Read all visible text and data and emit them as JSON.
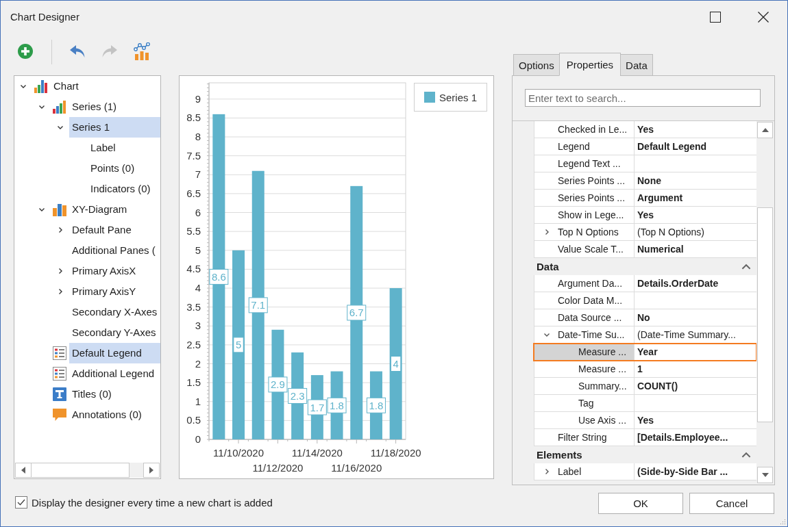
{
  "window": {
    "title": "Chart Designer"
  },
  "toolbar": {
    "groups": [
      [
        {
          "kind": "add",
          "disabled": false
        }
      ],
      [
        {
          "kind": "undo",
          "disabled": false
        },
        {
          "kind": "redo",
          "disabled": true
        },
        {
          "kind": "wizard",
          "disabled": false
        }
      ]
    ]
  },
  "tree": [
    {
      "label": "Chart",
      "kind": "chart",
      "expanded": true,
      "selected": false,
      "children": [
        {
          "label": "Series (1)",
          "kind": "series",
          "expanded": true,
          "selected": false,
          "children": [
            {
              "label": "Series 1",
              "expanded": true,
              "selected": true,
              "children": [
                {
                  "label": "Label",
                  "selected": false
                },
                {
                  "label": "Points (0)",
                  "selected": false
                },
                {
                  "label": "Indicators (0)",
                  "selected": false
                }
              ]
            }
          ]
        },
        {
          "label": "XY-Diagram",
          "kind": "diagram",
          "expanded": true,
          "selected": false,
          "children": [
            {
              "label": "Default Pane",
              "expanded": false,
              "selected": false
            },
            {
              "label": "Additional Panes (",
              "selected": false
            },
            {
              "label": "Primary AxisX",
              "expanded": false,
              "selected": false
            },
            {
              "label": "Primary AxisY",
              "expanded": false,
              "selected": false
            },
            {
              "label": "Secondary X-Axes",
              "selected": false
            },
            {
              "label": "Secondary Y-Axes",
              "selected": false
            }
          ]
        },
        {
          "label": "Default Legend",
          "kind": "legend",
          "selected": true
        },
        {
          "label": "Additional Legend",
          "kind": "legend",
          "selected": false
        },
        {
          "label": "Titles (0)",
          "kind": "titles",
          "selected": false
        },
        {
          "label": "Annotations (0)",
          "kind": "annotations",
          "selected": false
        }
      ]
    }
  ],
  "chart": {
    "chart_data": {
      "type": "bar",
      "categories": [
        null,
        "11/10/2020",
        null,
        "11/12/2020",
        null,
        "11/14/2020",
        null,
        "11/16/2020",
        null,
        "11/18/2020"
      ],
      "ylim": [
        0,
        9.43
      ],
      "yticks": [
        0,
        0.5,
        1,
        1.5,
        2,
        2.5,
        3,
        3.5,
        4,
        4.5,
        5,
        5.5,
        6,
        6.5,
        7,
        7.5,
        8,
        8.5,
        9
      ],
      "grid": true,
      "data_labels": true,
      "series": [
        {
          "name": "Series 1",
          "color": "#5fb3cb",
          "values": [
            8.6,
            5,
            7.1,
            2.9,
            2.3,
            1.7,
            1.8,
            6.7,
            1.8,
            4
          ]
        }
      ]
    }
  },
  "tabs": [
    {
      "label": "Options",
      "selected": false
    },
    {
      "label": "Properties",
      "selected": true
    },
    {
      "label": "Data",
      "selected": false
    }
  ],
  "search": {
    "placeholder": "Enter text to search..."
  },
  "property_grid": {
    "sections": [
      {
        "rows": [
          {
            "name": "Checked in Le...",
            "value": "Yes",
            "modified": true,
            "selected": false
          },
          {
            "name": "Legend",
            "value": "Default Legend",
            "modified": true,
            "selected": false
          },
          {
            "name": "Legend Text ...",
            "selected": false
          },
          {
            "name": "Series Points ...",
            "value": "None",
            "modified": true,
            "selected": false
          },
          {
            "name": "Series Points ...",
            "value": "Argument",
            "modified": true,
            "selected": false
          },
          {
            "name": "Show in Lege...",
            "value": "Yes",
            "modified": true,
            "selected": false
          },
          {
            "name": "Top N Options",
            "value": "(Top N Options)",
            "modified": false,
            "expanded": false,
            "selected": false
          },
          {
            "name": "Value Scale T...",
            "value": "Numerical",
            "modified": true,
            "selected": false
          }
        ]
      },
      {
        "title": "Data",
        "expanded": true,
        "rows": [
          {
            "name": "Argument Da...",
            "value": "Details.OrderDate",
            "modified": true,
            "selected": false
          },
          {
            "name": "Color Data M...",
            "selected": false
          },
          {
            "name": "Data Source ...",
            "value": "No",
            "modified": true,
            "selected": false
          },
          {
            "name": "Date-Time Su...",
            "value": "(Date-Time Summary...",
            "modified": false,
            "expanded": true,
            "selected": false,
            "children": [
              {
                "name": "Measure ...",
                "value": "Year",
                "modified": true,
                "selected": true
              },
              {
                "name": "Measure ...",
                "value": "1",
                "modified": true,
                "selected": false
              },
              {
                "name": "Summary...",
                "value": "COUNT()",
                "modified": true,
                "selected": false
              },
              {
                "name": "Tag",
                "selected": false
              },
              {
                "name": "Use Axis ...",
                "value": "Yes",
                "modified": true,
                "selected": false
              }
            ]
          },
          {
            "name": "Filter String",
            "value": "[Details.Employee...",
            "modified": true,
            "selected": false
          }
        ]
      },
      {
        "title": "Elements",
        "expanded": true,
        "rows": [
          {
            "name": "Label",
            "value": "(Side-by-Side Bar ...",
            "modified": true,
            "expanded": false,
            "selected": false
          }
        ]
      }
    ]
  },
  "footer": {
    "checkbox": {
      "label": "Display the designer every time a new chart is added",
      "checked": true
    },
    "buttons": [
      "OK",
      "Cancel"
    ]
  }
}
